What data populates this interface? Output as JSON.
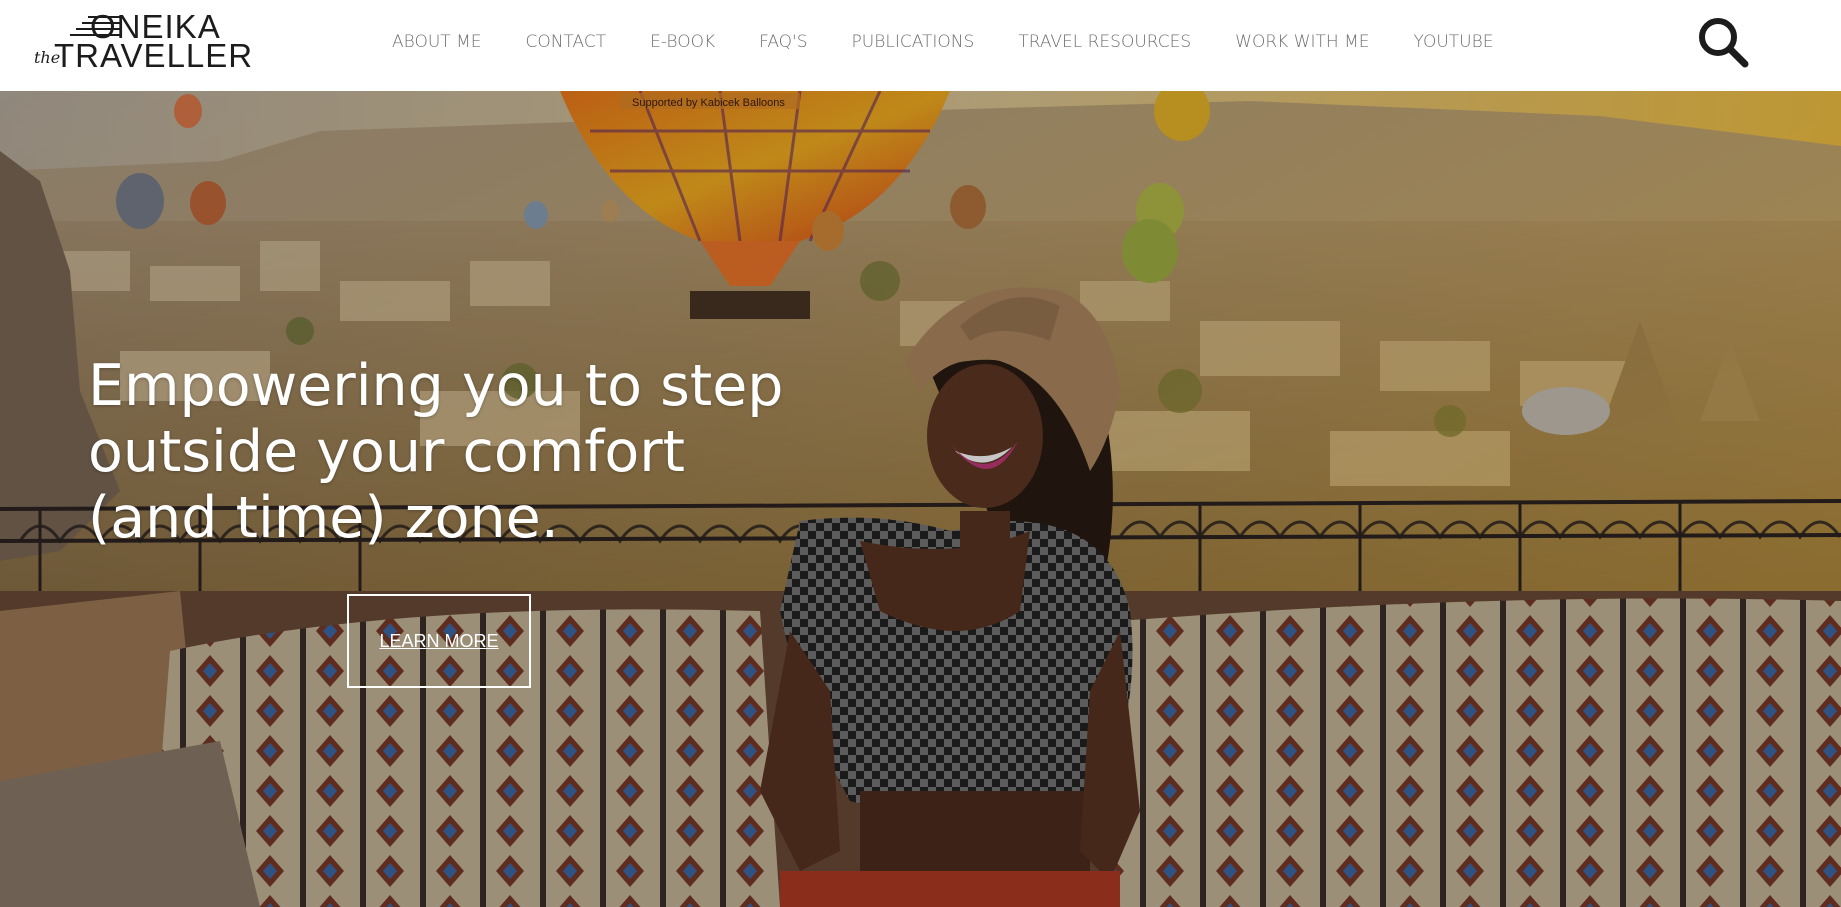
{
  "brand": {
    "logo_line1": "ONEIKA",
    "logo_prefix": "the",
    "logo_line2": "TRAVELLER"
  },
  "nav": {
    "items": [
      {
        "label": "ABOUT ME"
      },
      {
        "label": "CONTACT"
      },
      {
        "label": "E-BOOK"
      },
      {
        "label": "FAQ'S"
      },
      {
        "label": "PUBLICATIONS"
      },
      {
        "label": "TRAVEL RESOURCES"
      },
      {
        "label": "WORK WITH ME"
      },
      {
        "label": "YOUTUBE"
      }
    ],
    "search_icon": "search-icon"
  },
  "hero": {
    "headline": "Empowering you to step\noutside your comfort\n(and time) zone.",
    "cta_label": "LEARN MORE",
    "balloon_banner_text": "Supported by Kabicek Balloons"
  },
  "colors": {
    "header_bg": "#ffffff",
    "nav_text": "#6e6e6e",
    "logo": "#1c1c1c",
    "hero_text": "#ffffff"
  }
}
